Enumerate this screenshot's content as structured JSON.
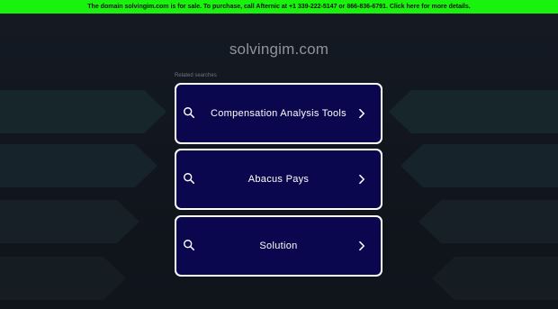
{
  "banner": {
    "text": "The domain solvingim.com is for sale. To purchase, call Afternic at +1 339-222-5147 or 866-836-6791. Click here for more details."
  },
  "page": {
    "domain": "solvingim.com",
    "related_label": "Related searches"
  },
  "related_searches": [
    {
      "label": "Compensation Analysis Tools"
    },
    {
      "label": "Abacus Pays"
    },
    {
      "label": "Solution"
    }
  ],
  "icons": {
    "search": "search-icon",
    "chevron": "chevron-right-icon"
  },
  "colors": {
    "banner_bg": "#19f20d",
    "page_bg": "#121821",
    "result_bg": "#0a074f",
    "result_border": "#ffffff",
    "title_text": "#8e949a"
  }
}
